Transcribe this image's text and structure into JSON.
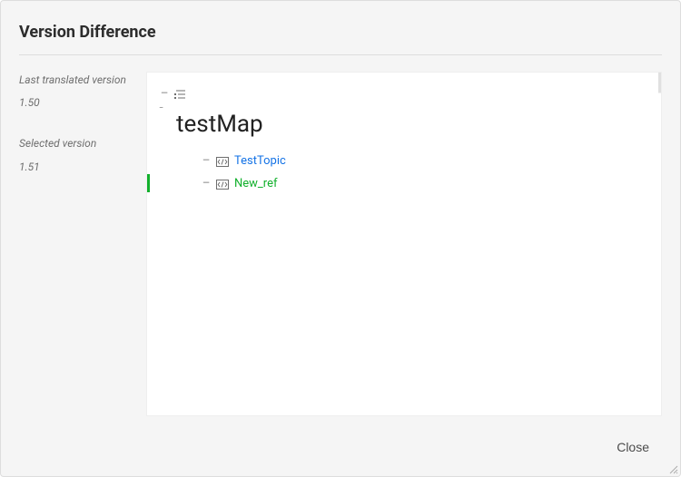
{
  "dialog": {
    "title": "Version Difference",
    "close_label": "Close"
  },
  "sidebar": {
    "last_translated": {
      "label": "Last translated version",
      "value": "1.50"
    },
    "selected": {
      "label": "Selected version",
      "value": "1.51"
    }
  },
  "tree": {
    "root_title": "testMap",
    "items": [
      {
        "label": "TestTopic",
        "state": "unchanged"
      },
      {
        "label": "New_ref",
        "state": "added"
      }
    ]
  },
  "icons": {
    "map": "list-icon",
    "topic": "code-box-icon"
  },
  "colors": {
    "link": "#1473e6",
    "added": "#12b02c"
  }
}
